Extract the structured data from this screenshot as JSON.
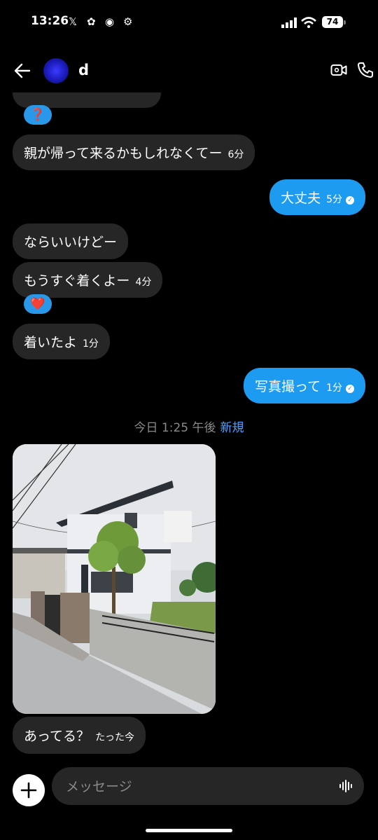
{
  "status_bar": {
    "time": "13:26",
    "battery": "74"
  },
  "header": {
    "contact_name": "d"
  },
  "messages": [
    {
      "text": "親が帰って来るかもしれなくてー",
      "time": "6分"
    },
    {
      "text": "大丈夫",
      "time": "5分"
    },
    {
      "text": "ならいいけどー"
    },
    {
      "text": "もうすぐ着くよー",
      "time": "4分"
    },
    {
      "text": "着いたよ",
      "time": "1分"
    },
    {
      "text": "写真撮って",
      "time": "1分"
    },
    {
      "text": "あってる？",
      "time": "たった今"
    }
  ],
  "reactions": [
    "❓",
    "❤️"
  ],
  "separator": {
    "label": "今日 1:25 午後",
    "new_label": "新規"
  },
  "composer": {
    "placeholder": "メッセージ"
  },
  "colors": {
    "accent": "#1d9bf0",
    "bubble": "#262626",
    "background": "#000000"
  },
  "icons": [
    "back-arrow-icon",
    "video-call-icon",
    "phone-icon",
    "plus-icon",
    "voice-icon",
    "check-icon"
  ]
}
